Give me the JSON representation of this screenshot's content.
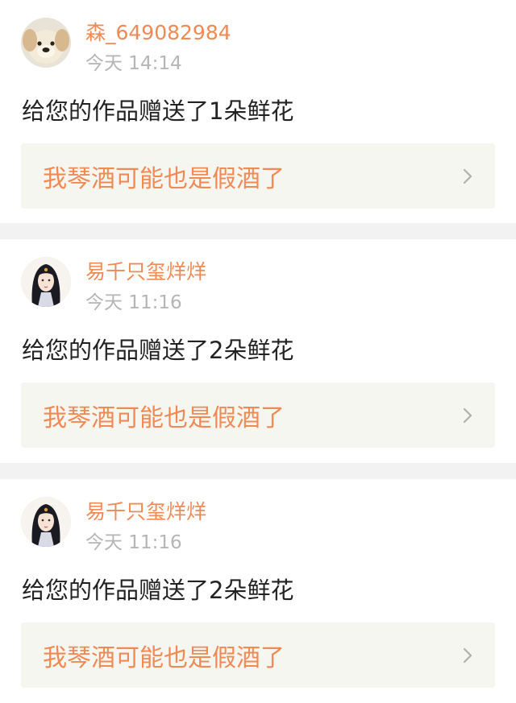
{
  "notifications": [
    {
      "avatar_icon": "puppy-avatar",
      "username": "森_649082984",
      "time": "今天 14:14",
      "message": "给您的作品赠送了1朵鲜花",
      "post_title": "我琴酒可能也是假酒了"
    },
    {
      "avatar_icon": "anime-girl-avatar",
      "username": "易千只玺烊烊",
      "time": "今天 11:16",
      "message": "给您的作品赠送了2朵鲜花",
      "post_title": "我琴酒可能也是假酒了"
    },
    {
      "avatar_icon": "anime-girl-avatar",
      "username": "易千只玺烊烊",
      "time": "今天 11:16",
      "message": "给您的作品赠送了2朵鲜花",
      "post_title": "我琴酒可能也是假酒了"
    }
  ],
  "colors": {
    "accent": "#ef8a55",
    "timestamp": "#b5b5b5",
    "text": "#222222",
    "link_background": "#f6f6f0",
    "divider": "#f2f2f2"
  }
}
